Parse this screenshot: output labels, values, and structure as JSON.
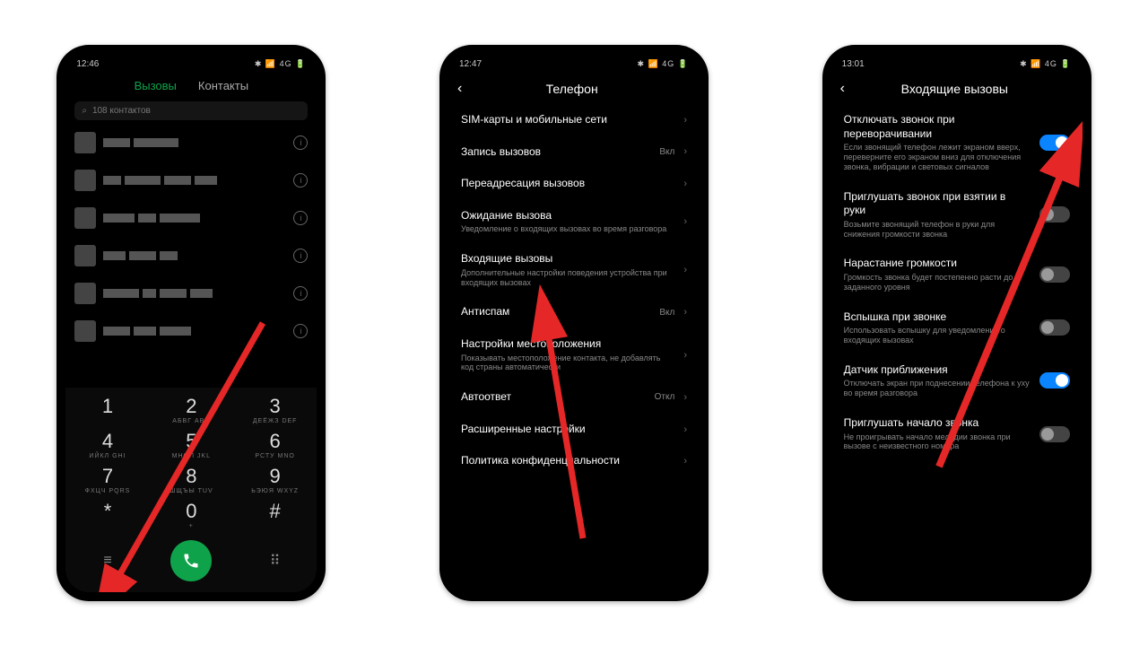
{
  "phone1": {
    "time": "12:46",
    "status_right": "✱ 📶 4G 🔋",
    "tabs": {
      "calls": "Вызовы",
      "contacts": "Контакты"
    },
    "search_placeholder": "108 контактов",
    "dialpad": [
      [
        {
          "n": "1",
          "l": ""
        },
        {
          "n": "2",
          "l": "АБВГ ABC"
        },
        {
          "n": "3",
          "l": "ДЕЁЖЗ DEF"
        }
      ],
      [
        {
          "n": "4",
          "l": "ИЙКЛ GHI"
        },
        {
          "n": "5",
          "l": "МНОП JKL"
        },
        {
          "n": "6",
          "l": "РСТУ MNO"
        }
      ],
      [
        {
          "n": "7",
          "l": "ФХЦЧ PQRS"
        },
        {
          "n": "8",
          "l": "ШЩЪЫ TUV"
        },
        {
          "n": "9",
          "l": "ЬЭЮЯ WXYZ"
        }
      ],
      [
        {
          "n": "*",
          "l": ""
        },
        {
          "n": "0",
          "l": "+"
        },
        {
          "n": "#",
          "l": ""
        }
      ]
    ]
  },
  "phone2": {
    "time": "12:47",
    "status_right": "✱ 📶 4G 🔋",
    "title": "Телефон",
    "items": [
      {
        "label": "SIM-карты и мобильные сети",
        "sub": "",
        "val": "",
        "chev": true
      },
      {
        "label": "Запись вызовов",
        "sub": "",
        "val": "Вкл",
        "chev": true
      },
      {
        "label": "Переадресация вызовов",
        "sub": "",
        "val": "",
        "chev": true
      },
      {
        "label": "Ожидание вызова",
        "sub": "Уведомление о входящих вызовах во время разговора",
        "val": "",
        "chev": true
      },
      {
        "label": "Входящие вызовы",
        "sub": "Дополнительные настройки поведения устройства при входящих вызовах",
        "val": "",
        "chev": true
      },
      {
        "label": "Антиспам",
        "sub": "",
        "val": "Вкл",
        "chev": true
      },
      {
        "label": "Настройки местоположения",
        "sub": "Показывать местоположение контакта, не добавлять код страны автоматически",
        "val": "",
        "chev": true
      },
      {
        "label": "Автоответ",
        "sub": "",
        "val": "Откл",
        "chev": true
      },
      {
        "label": "Расширенные настройки",
        "sub": "",
        "val": "",
        "chev": true
      },
      {
        "label": "Политика конфиденциальности",
        "sub": "",
        "val": "",
        "chev": true
      }
    ]
  },
  "phone3": {
    "time": "13:01",
    "status_right": "✱ 📶 4G 🔋",
    "title": "Входящие вызовы",
    "items": [
      {
        "label": "Отключать звонок при переворачивании",
        "sub": "Если звонящий телефон лежит экраном вверх, переверните его экраном вниз для отключения звонка, вибрации и световых сигналов",
        "toggle": true,
        "on": true
      },
      {
        "label": "Приглушать звонок при взятии в руки",
        "sub": "Возьмите звонящий телефон в руки для снижения громкости звонка",
        "toggle": true,
        "on": false
      },
      {
        "label": "Нарастание громкости",
        "sub": "Громкость звонка будет постепенно расти до заданного уровня",
        "toggle": true,
        "on": false
      },
      {
        "label": "Вспышка при звонке",
        "sub": "Использовать вспышку для уведомления о входящих вызовах",
        "toggle": true,
        "on": false
      },
      {
        "label": "Датчик приближения",
        "sub": "Отключать экран при поднесении телефона к уху во время разговора",
        "toggle": true,
        "on": true
      },
      {
        "label": "Приглушать начало звонка",
        "sub": "Не проигрывать начало мелодии звонка при вызове с неизвестного номера",
        "toggle": true,
        "on": false
      }
    ]
  }
}
